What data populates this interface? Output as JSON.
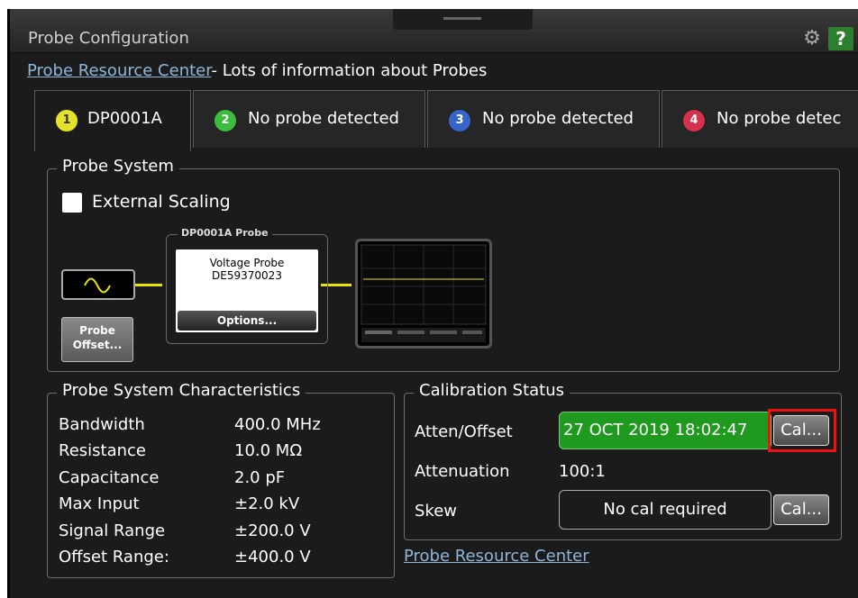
{
  "window": {
    "title": "Probe Configuration",
    "help_label": "?"
  },
  "header": {
    "link_label": "Probe Resource Center",
    "link_suffix": "- Lots of information about Probes"
  },
  "tabs": [
    {
      "number": "1",
      "label": "DP0001A",
      "color": "#e6e22a"
    },
    {
      "number": "2",
      "label": "No probe detected",
      "color": "#3dbd3d"
    },
    {
      "number": "3",
      "label": "No probe detected",
      "color": "#3565c9"
    },
    {
      "number": "4",
      "label": "No probe detec",
      "color": "#d6324e"
    }
  ],
  "probe_system": {
    "legend": "Probe System",
    "external_scaling_label": "External Scaling",
    "external_scaling_checked": false,
    "probe_box_title": "DP0001A  Probe",
    "probe_type": "Voltage Probe",
    "probe_serial": "DE59370023",
    "options_label": "Options...",
    "offset_label_1": "Probe",
    "offset_label_2": "Offset..."
  },
  "characteristics": {
    "legend": "Probe System Characteristics",
    "rows": [
      {
        "key": "Bandwidth",
        "value": "400.0 MHz"
      },
      {
        "key": "Resistance",
        "value": "10.0 MΩ"
      },
      {
        "key": "Capacitance",
        "value": "2.0 pF"
      },
      {
        "key": "Max Input",
        "value": "±2.0 kV"
      },
      {
        "key": "Signal Range",
        "value": "±200.0 V"
      },
      {
        "key": "Offset Range:",
        "value": "±400.0 V"
      }
    ]
  },
  "calibration": {
    "legend": "Calibration Status",
    "atten_offset_label": "Atten/Offset",
    "atten_offset_value": "27 OCT 2019 18:02:47",
    "attenuation_label": "Attenuation",
    "attenuation_value": "100:1",
    "skew_label": "Skew",
    "skew_value": "No cal required",
    "cal_button_label": "Cal...",
    "footer_link": "Probe Resource Center"
  }
}
